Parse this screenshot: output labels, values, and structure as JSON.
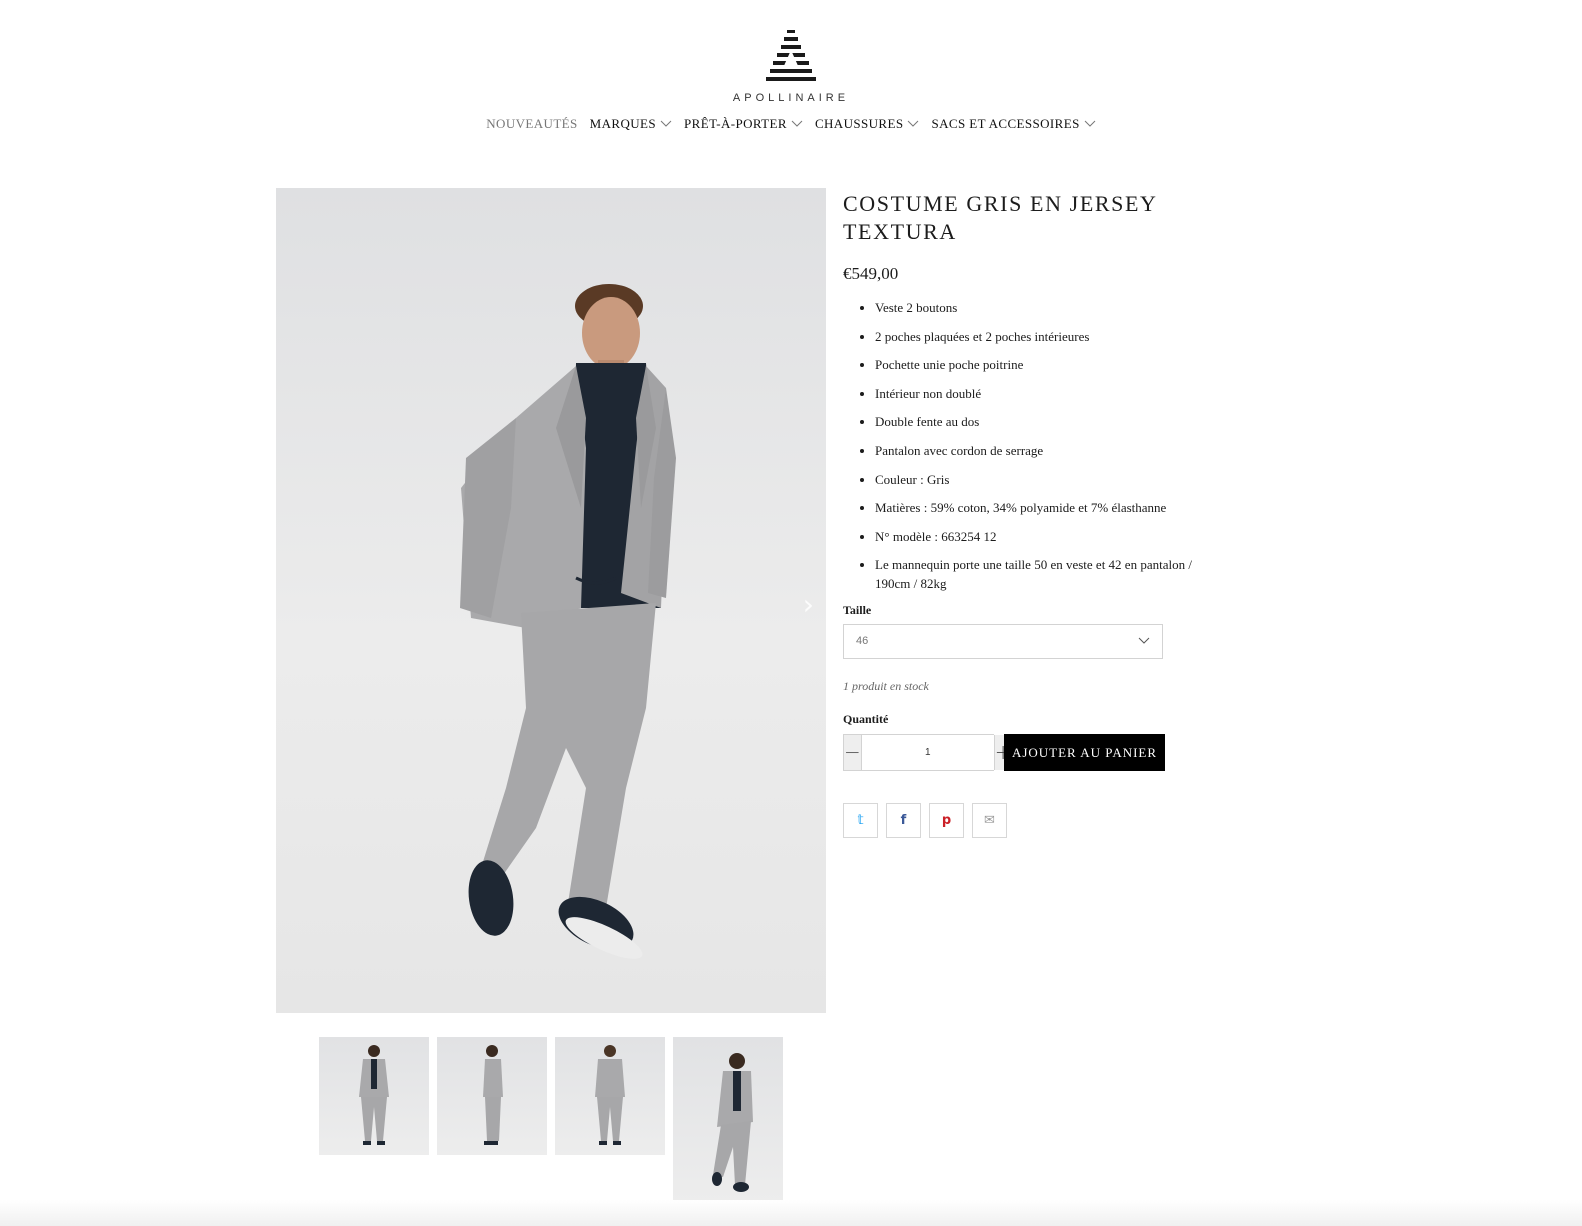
{
  "brand": {
    "name": "APOLLINAIRE",
    "logo_icon": "striped-a-logo-icon"
  },
  "nav": [
    {
      "label": "NOUVEAUTÉS",
      "has_dropdown": false
    },
    {
      "label": "MARQUES",
      "has_dropdown": true
    },
    {
      "label": "PRÊT-À-PORTER",
      "has_dropdown": true
    },
    {
      "label": "CHAUSSURES",
      "has_dropdown": true
    },
    {
      "label": "SACS ET ACCESSOIRES",
      "has_dropdown": true
    }
  ],
  "product": {
    "title": "COSTUME GRIS EN JERSEY TEXTURA",
    "price": "€549,00",
    "features": [
      "Veste 2 boutons",
      "2 poches plaquées et 2 poches intérieures",
      "Pochette unie poche poitrine",
      "Intérieur non doublé",
      "Double fente au dos",
      "Pantalon avec cordon de serrage",
      "Couleur : Gris",
      "Matières : 59% coton, 34% polyamide et 7% élasthanne",
      "N° modèle : 663254 12",
      "Le mannequin porte une taille 50 en veste et 42 en pantalon / 190cm / 82kg"
    ],
    "size_label": "Taille",
    "size_selected": "46",
    "stock_text": "1 produit en stock",
    "quantity_label": "Quantité",
    "quantity_value": "1",
    "add_to_cart_label": "AJOUTER AU PANIER"
  },
  "gallery": {
    "thumbnail_count": 4,
    "next_arrow": "›"
  },
  "share": {
    "twitter": "𝕥",
    "facebook": "f",
    "pinterest": "p",
    "email": "✉"
  },
  "colors": {
    "text": "#1c1c1c",
    "button_bg": "#000000",
    "suit_grey": "#a9a9ab",
    "shirt_navy": "#1e2733"
  }
}
